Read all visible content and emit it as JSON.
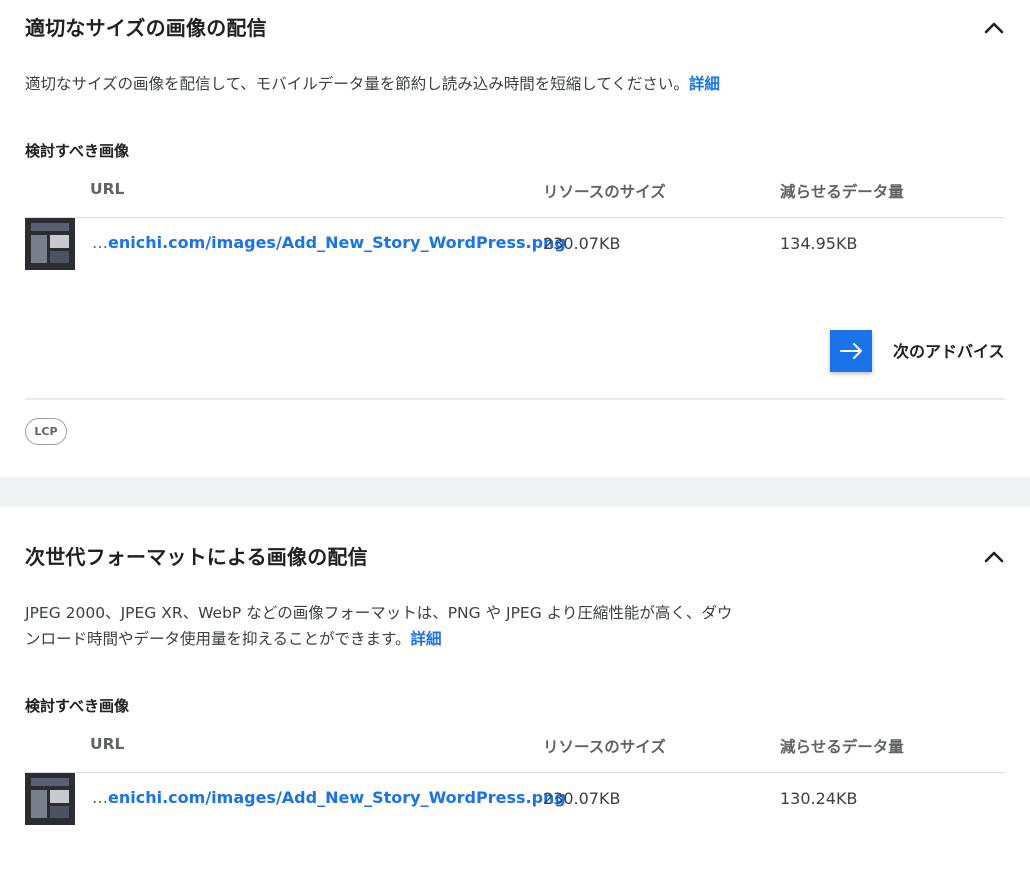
{
  "section1": {
    "title": "適切なサイズの画像の配信",
    "description": "適切なサイズの画像を配信して、モバイルデータ量を節約し読み込み時間を短縮してください。",
    "learn_more": "詳細",
    "subheading": "検討すべき画像",
    "columns": {
      "url": "URL",
      "size": "リソースのサイズ",
      "savings": "減らせるデータ量"
    },
    "rows": [
      {
        "url_prefix": "…",
        "url": "enichi.com/images/Add_New_Story_WordPress.png",
        "size": "230.07KB",
        "savings": "134.95KB"
      }
    ],
    "next_label": "次のアドバイス",
    "tag": "LCP"
  },
  "section2": {
    "title": "次世代フォーマットによる画像の配信",
    "description": "JPEG 2000、JPEG XR、WebP などの画像フォーマットは、PNG や JPEG より圧縮性能が高く、ダウンロード時間やデータ使用量を抑えることができます。",
    "learn_more": "詳細",
    "subheading": "検討すべき画像",
    "columns": {
      "url": "URL",
      "size": "リソースのサイズ",
      "savings": "減らせるデータ量"
    },
    "rows": [
      {
        "url_prefix": "…",
        "url": "enichi.com/images/Add_New_Story_WordPress.png",
        "size": "230.07KB",
        "savings": "130.24KB"
      }
    ]
  },
  "icons": {
    "collapse": "chevron-up-icon",
    "next": "arrow-right-icon"
  },
  "colors": {
    "link": "#1a73e8",
    "button": "#1a73e8",
    "text": "#202124"
  }
}
